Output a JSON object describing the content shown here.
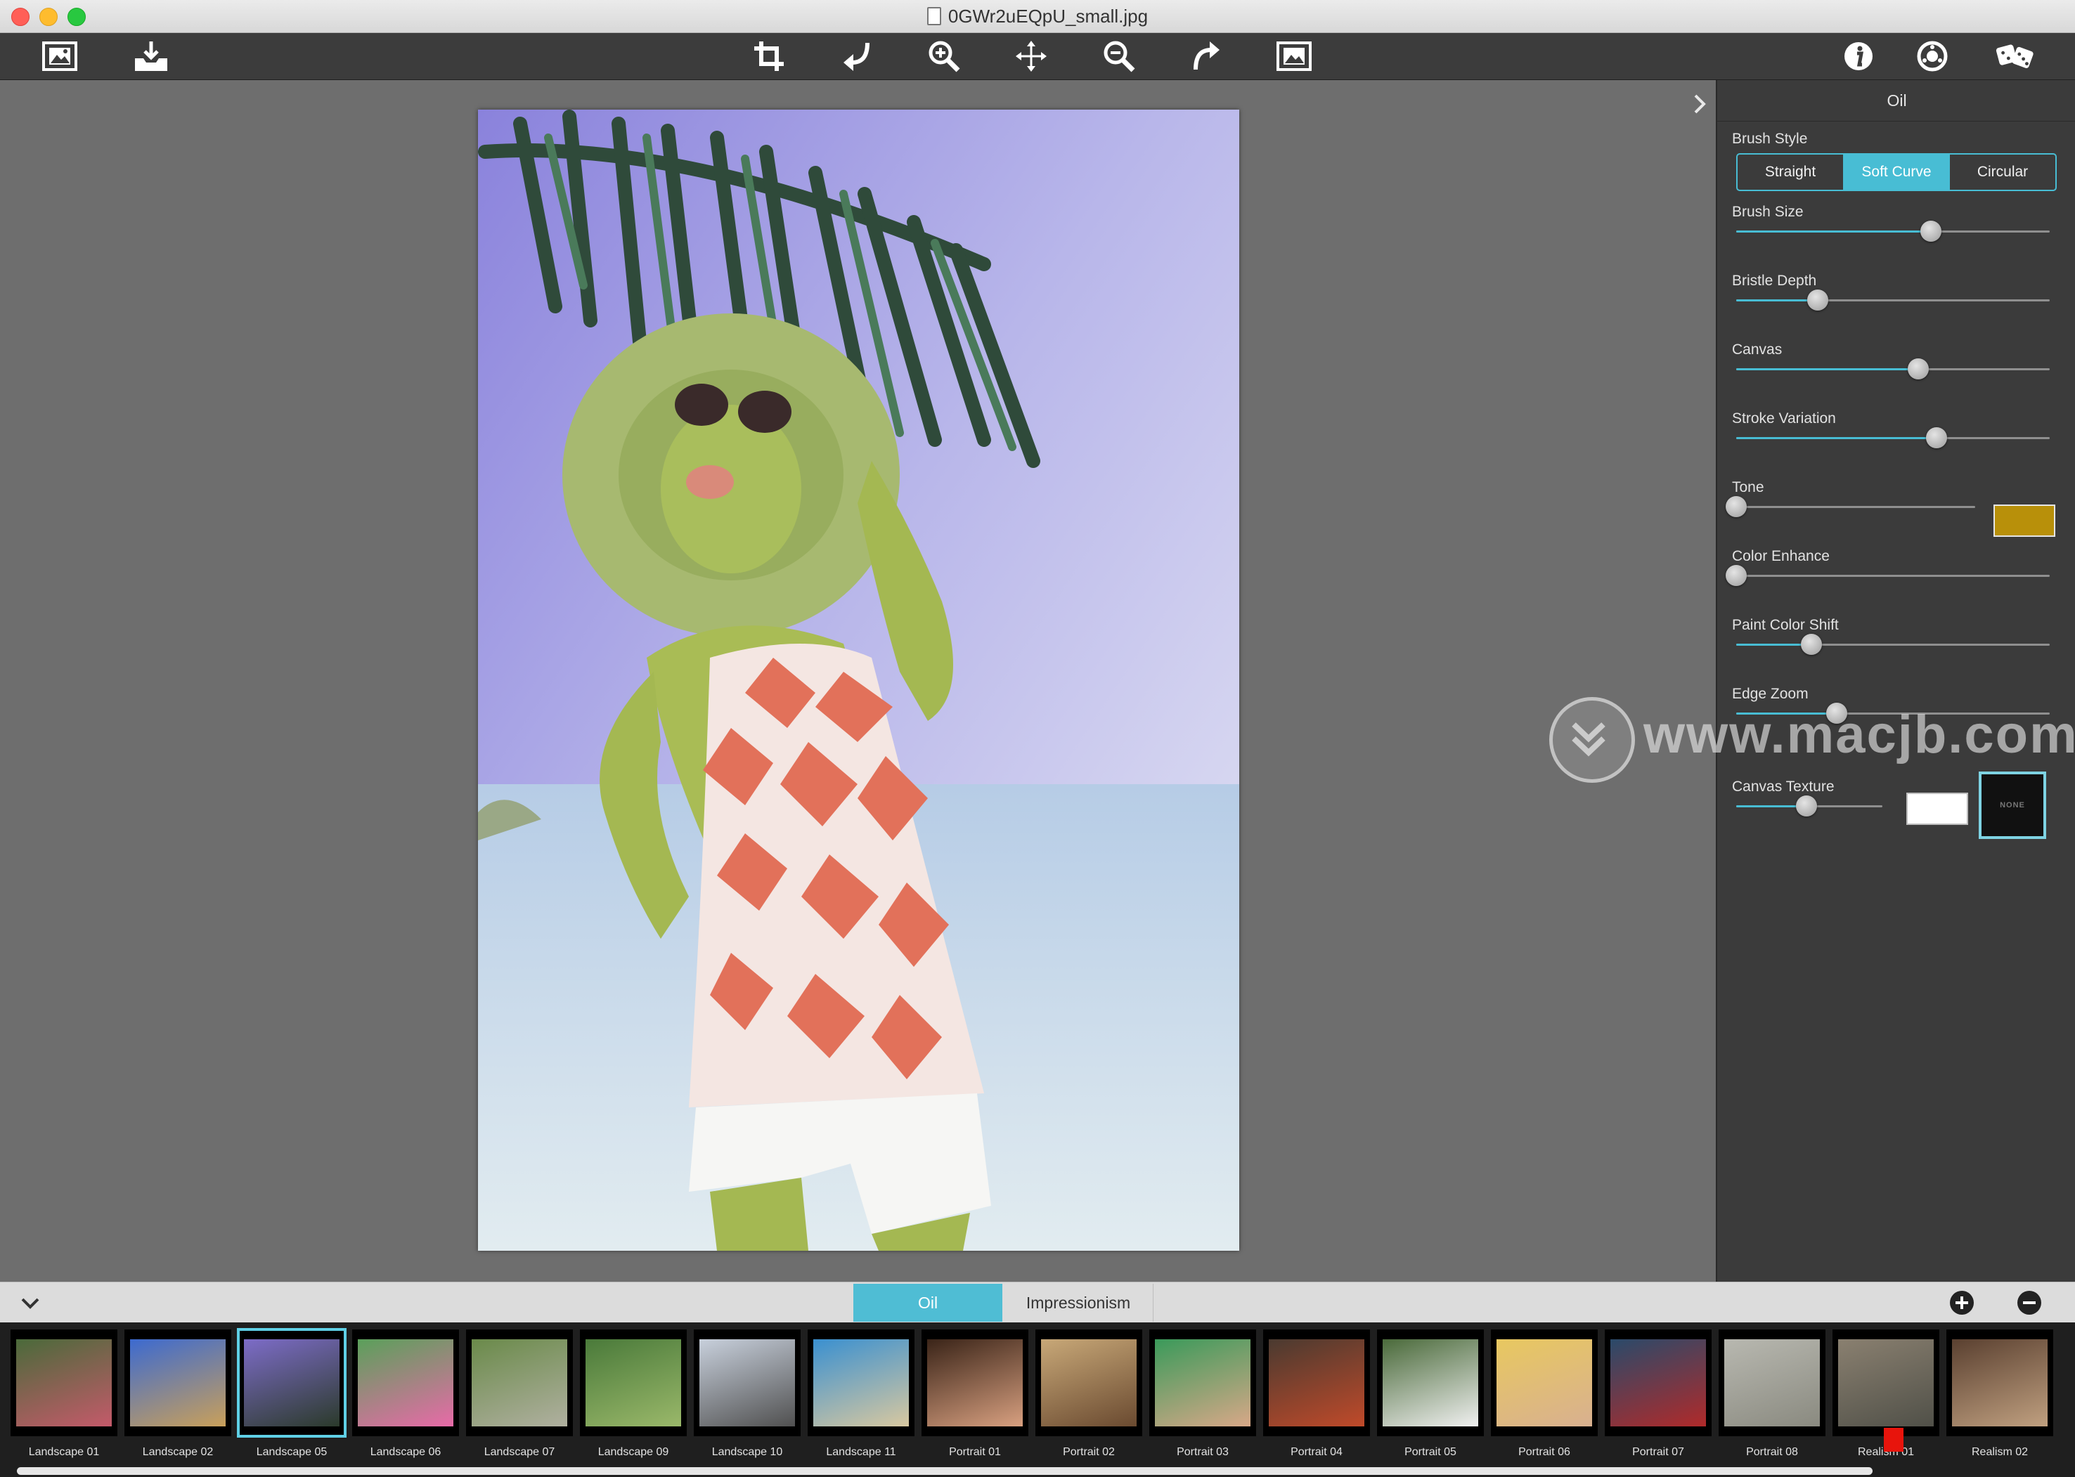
{
  "window": {
    "title": "0GWr2uEQpU_small.jpg",
    "traffic_lights": [
      "#ff5f57",
      "#febc2e",
      "#28c840"
    ]
  },
  "toolbar": {
    "left_icons": [
      "open-image-icon",
      "save-icon"
    ],
    "center_icons": [
      "crop-icon",
      "rotate-left-icon",
      "zoom-in-icon",
      "move-icon",
      "zoom-out-icon",
      "rotate-right-icon",
      "fit-image-icon"
    ],
    "right_icons": [
      "info-icon",
      "settings-icon",
      "random-dice-icon"
    ]
  },
  "panel": {
    "title": "Oil",
    "brush_style": {
      "label": "Brush Style",
      "options": [
        "Straight",
        "Soft Curve",
        "Circular"
      ],
      "selected": "Soft Curve"
    },
    "sliders": [
      {
        "label": "Brush Size",
        "value": 0.62
      },
      {
        "label": "Bristle Depth",
        "value": 0.26
      },
      {
        "label": "Canvas",
        "value": 0.58
      },
      {
        "label": "Stroke Variation",
        "value": 0.64
      },
      {
        "label": "Tone",
        "value": 0.0
      },
      {
        "label": "Color Enhance",
        "value": 0.0
      },
      {
        "label": "Paint Color Shift",
        "value": 0.24
      },
      {
        "label": "Edge Zoom",
        "value": 0.32
      }
    ],
    "tone_color": "#b8900a",
    "canvas_texture": {
      "label": "Canvas Texture",
      "value": 0.48,
      "swatch_color": "#ffffff",
      "none_label": "NONE"
    },
    "accent": "#48bdd4"
  },
  "watermark": {
    "text": "www.macjb.com"
  },
  "bottom": {
    "tabs": [
      "Oil",
      "Impressionism"
    ],
    "active_tab": "Oil",
    "add_icon": "plus-circle-icon",
    "remove_icon": "minus-circle-icon",
    "presets": [
      {
        "label": "Landscape 01",
        "c1": "#4a6a3a",
        "c2": "#c45a6a"
      },
      {
        "label": "Landscape 02",
        "c1": "#3c6ad0",
        "c2": "#c9a05a"
      },
      {
        "label": "Landscape 05",
        "c1": "#7d6cc8",
        "c2": "#2b3a2b"
      },
      {
        "label": "Landscape 06",
        "c1": "#5aa05a",
        "c2": "#e86aa8"
      },
      {
        "label": "Landscape 07",
        "c1": "#6a8a4a",
        "c2": "#b0b0a0"
      },
      {
        "label": "Landscape 09",
        "c1": "#4a7a3a",
        "c2": "#9ab86a"
      },
      {
        "label": "Landscape 10",
        "c1": "#c8d0dc",
        "c2": "#505050"
      },
      {
        "label": "Landscape 11",
        "c1": "#3a90d0",
        "c2": "#d8c8a0"
      },
      {
        "label": "Portrait 01",
        "c1": "#3a2418",
        "c2": "#d8a080"
      },
      {
        "label": "Portrait 02",
        "c1": "#c8a878",
        "c2": "#6a4a30"
      },
      {
        "label": "Portrait 03",
        "c1": "#3a9a5a",
        "c2": "#d8a888"
      },
      {
        "label": "Portrait 04",
        "c1": "#4a3a30",
        "c2": "#c04a2a"
      },
      {
        "label": "Portrait 05",
        "c1": "#4a6a3a",
        "c2": "#f0f0f0"
      },
      {
        "label": "Portrait 06",
        "c1": "#e8c860",
        "c2": "#d8b090"
      },
      {
        "label": "Portrait 07",
        "c1": "#2a4a6a",
        "c2": "#b02a2a"
      },
      {
        "label": "Portrait 08",
        "c1": "#b8b8b0",
        "c2": "#8a8a80"
      },
      {
        "label": "Realism 01",
        "c1": "#8a8070",
        "c2": "#505048"
      },
      {
        "label": "Realism 02",
        "c1": "#5a4030",
        "c2": "#c0a080"
      }
    ],
    "selected_preset": "Landscape 05"
  }
}
